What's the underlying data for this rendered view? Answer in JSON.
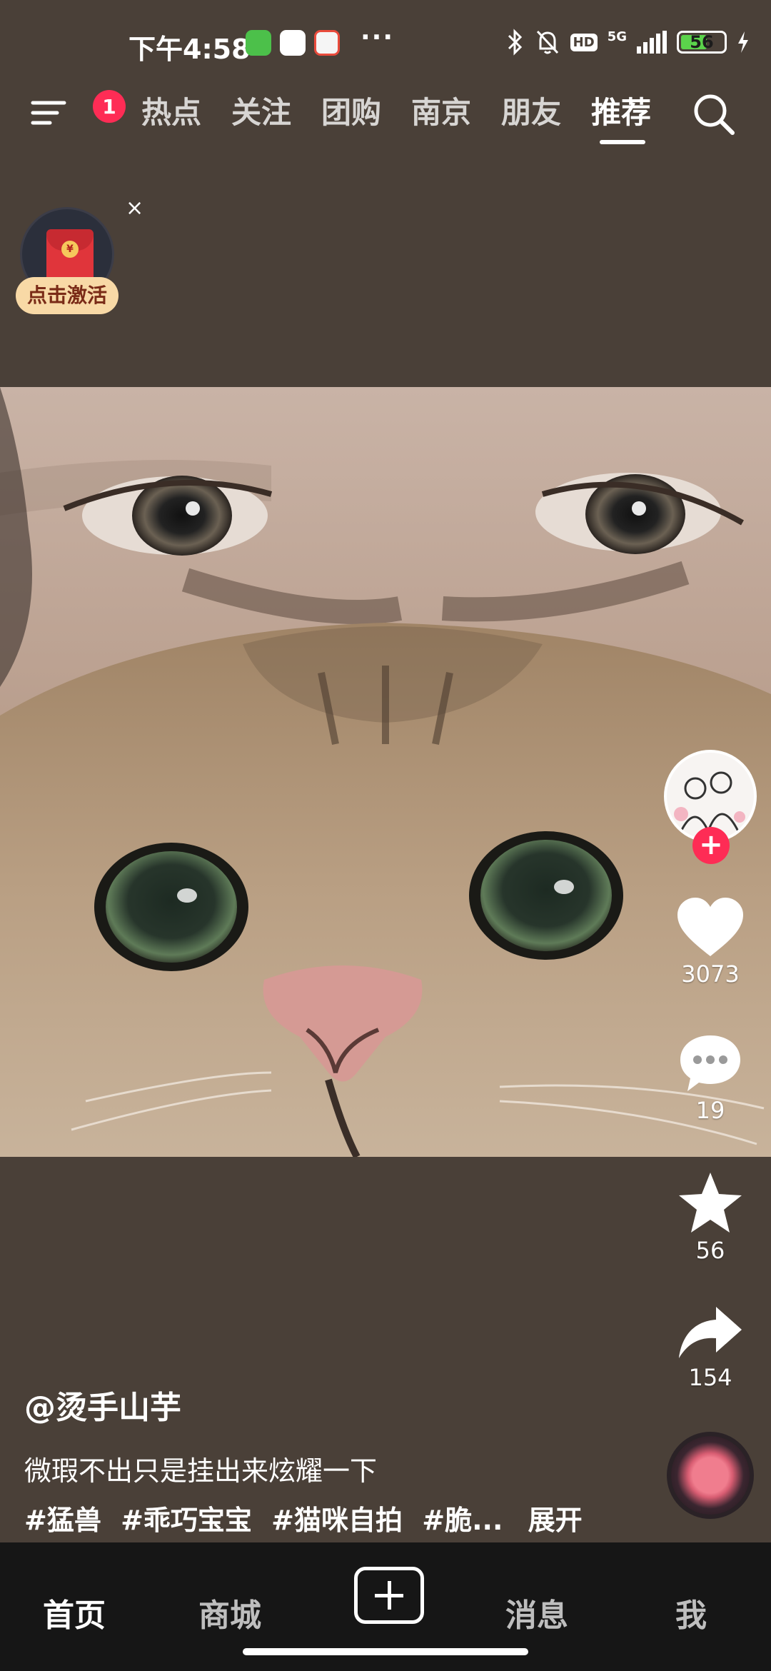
{
  "status_bar": {
    "time": "下午4:58",
    "more": "···",
    "network": "5G",
    "hd": "HD",
    "battery_percent": "56"
  },
  "top_nav": {
    "menu_badge": "1",
    "partial_tab": "",
    "tabs": [
      "热点",
      "关注",
      "团购",
      "南京",
      "朋友",
      "推荐"
    ],
    "active_tab": "推荐"
  },
  "red_packet": {
    "label": "点击激活",
    "close": "×",
    "coin": "¥"
  },
  "actions": {
    "follow": "+",
    "likes": "3073",
    "comments": "19",
    "favorites": "56",
    "shares": "154"
  },
  "caption": {
    "author": "@烫手山芋",
    "description": "微瑕不出只是挂出来炫耀一下",
    "tags": [
      "#猛兽",
      "#乖巧宝宝",
      "#猫咪自拍",
      "#脆..."
    ],
    "expand": "展开"
  },
  "bottom_nav": {
    "home": "首页",
    "mall": "商城",
    "messages": "消息",
    "me": "我"
  },
  "colors": {
    "accent": "#fe2c55",
    "background": "#4a4038",
    "bottom_bar": "#161616"
  }
}
